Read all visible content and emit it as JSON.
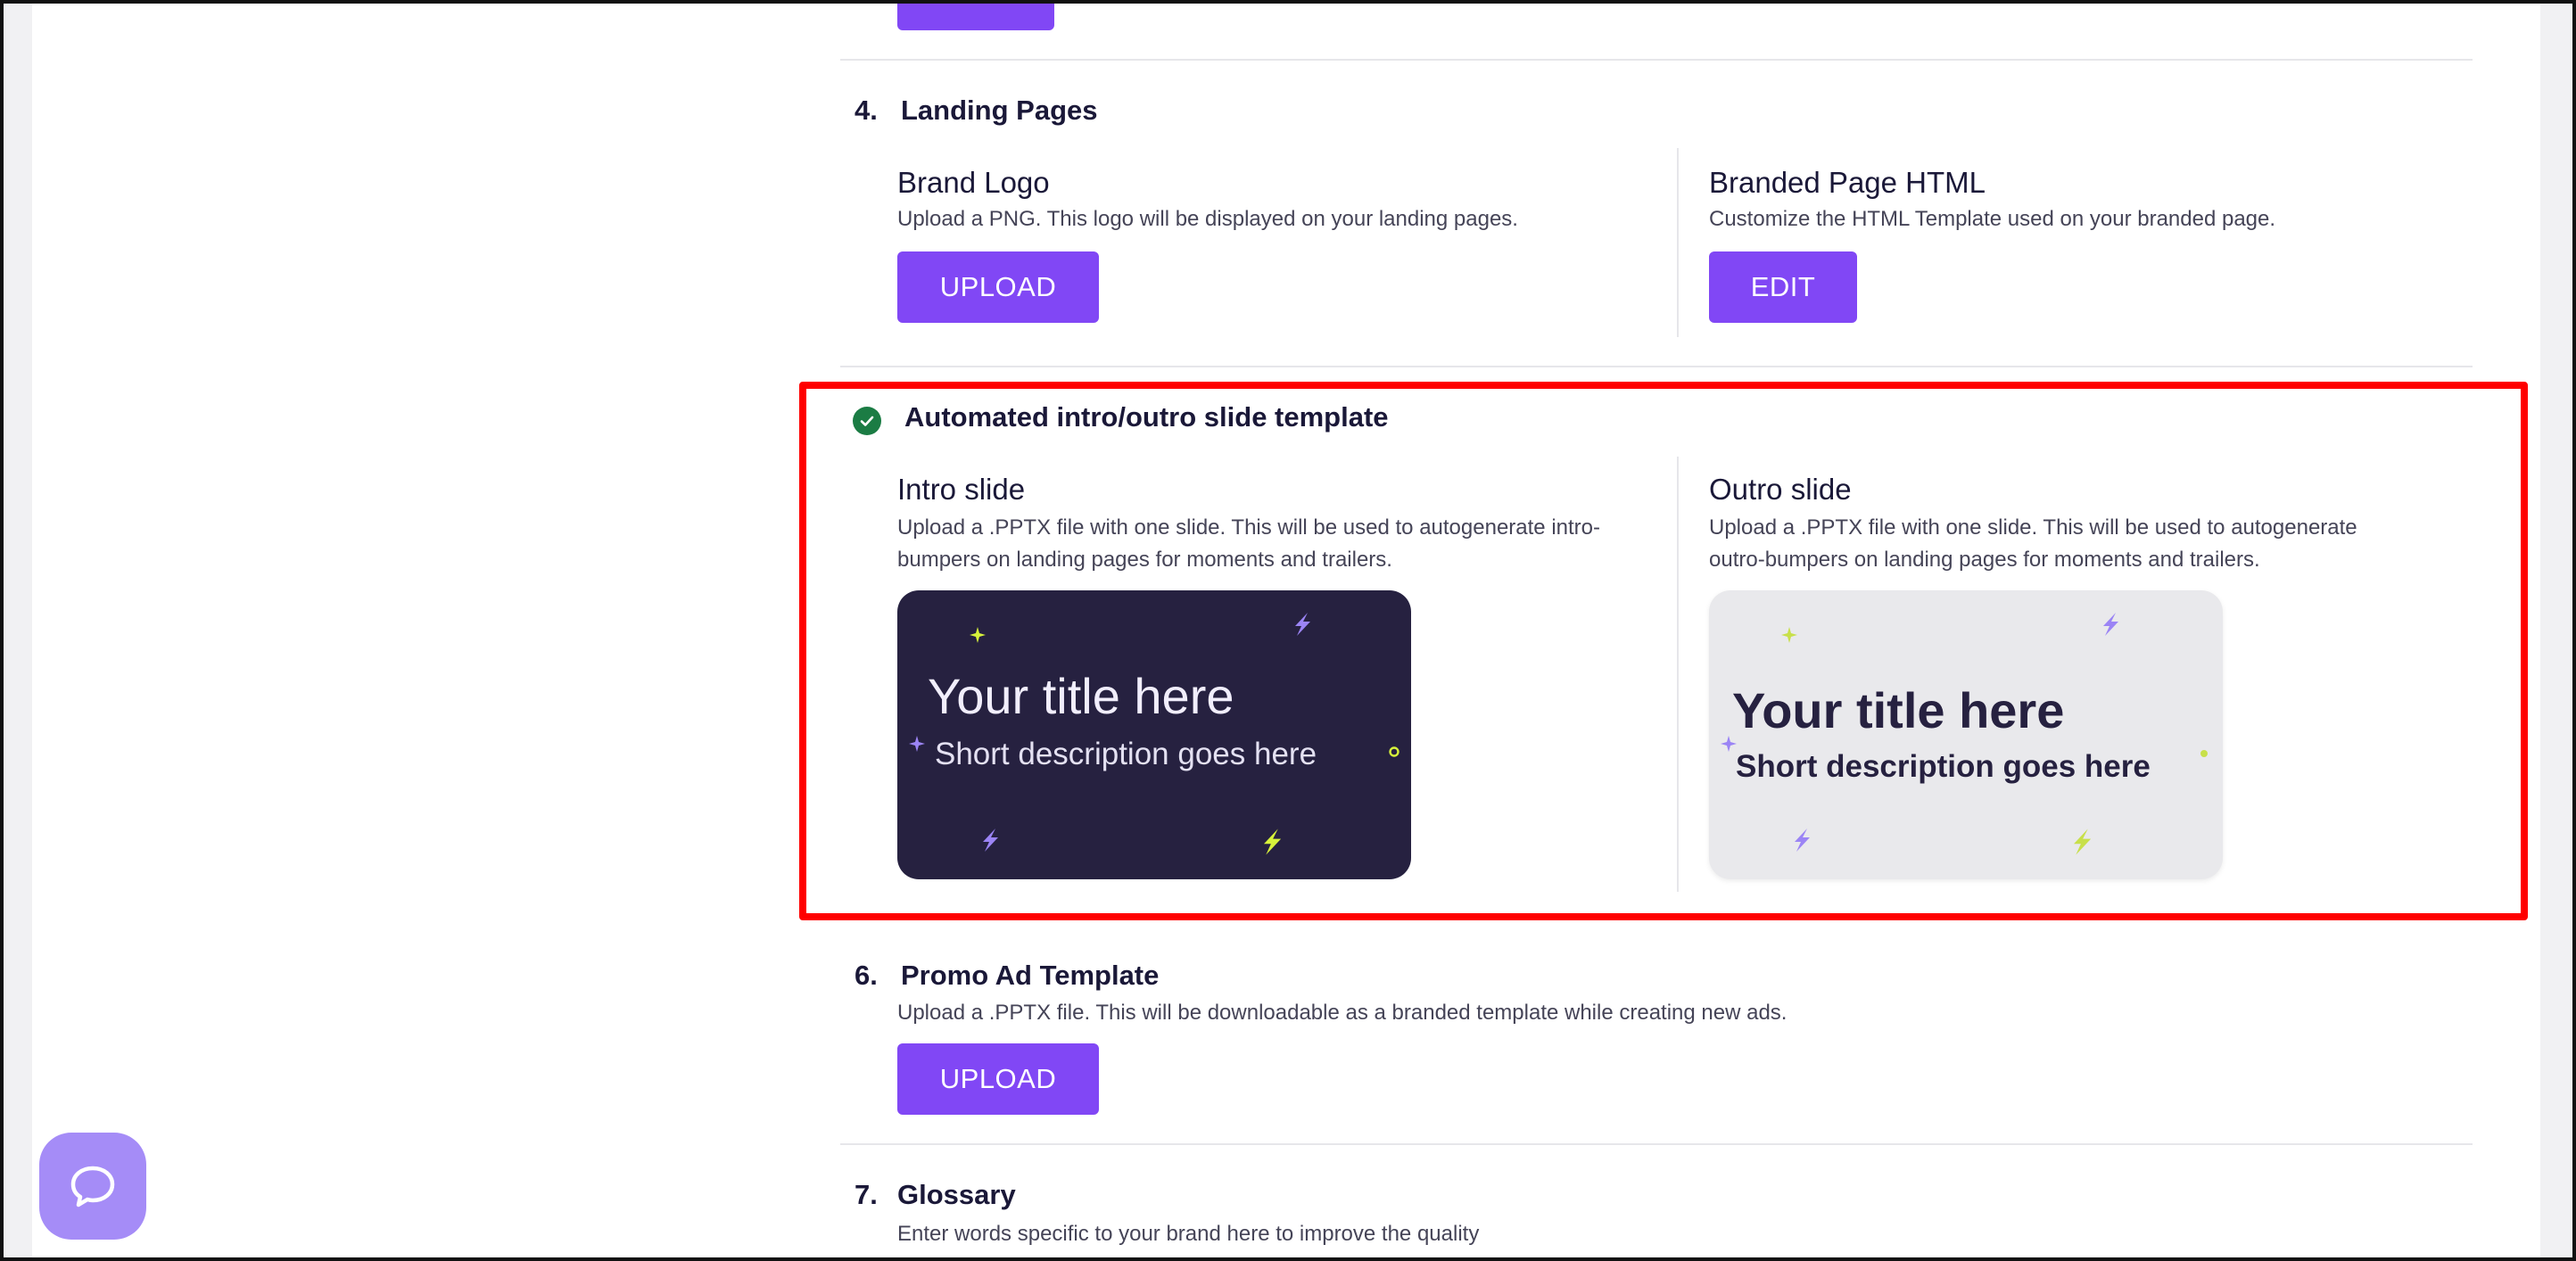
{
  "sections": {
    "landing_pages": {
      "number": "4.",
      "title": "Landing Pages",
      "brand_logo": {
        "title": "Brand Logo",
        "description": "Upload a PNG. This logo will be displayed on your landing pages.",
        "button": "UPLOAD"
      },
      "branded_page": {
        "title": "Branded Page HTML",
        "description": "Customize the HTML Template used on your branded page.",
        "button": "EDIT"
      }
    },
    "intro_outro": {
      "title": "Automated intro/outro slide template",
      "intro": {
        "title": "Intro slide",
        "description_line1": "Upload a .PPTX file with one slide. This will be used to autogenerate intro-",
        "description_line2": "bumpers on landing pages for moments and trailers.",
        "preview_title": "Your title here",
        "preview_desc": "Short description goes here"
      },
      "outro": {
        "title": "Outro slide",
        "description_line1": "Upload a .PPTX file with one slide. This will be used to autogenerate",
        "description_line2": "outro-bumpers on landing pages for moments and trailers.",
        "preview_title": "Your title here",
        "preview_desc": "Short description goes here"
      }
    },
    "promo_ad": {
      "number": "6.",
      "title": "Promo Ad Template",
      "description": "Upload a .PPTX file. This will be downloadable as a branded template while creating new ads.",
      "button": "UPLOAD"
    },
    "glossary": {
      "number": "7.",
      "title": "Glossary",
      "description": "Enter words specific to your brand here to improve the quality"
    }
  },
  "colors": {
    "accent": "#8147f5",
    "highlight": "#ff0000",
    "check": "#1b7c44",
    "slide_dark": "#262140",
    "slide_light": "#e9e9ec",
    "spark_purple": "#9b84f5",
    "spark_lime": "#d7f23b"
  },
  "icons": {
    "check": "check-circle-icon",
    "chat": "chat-bubble-icon",
    "sparks": [
      "sparkle-icon",
      "lightning-icon",
      "ring-icon"
    ]
  }
}
